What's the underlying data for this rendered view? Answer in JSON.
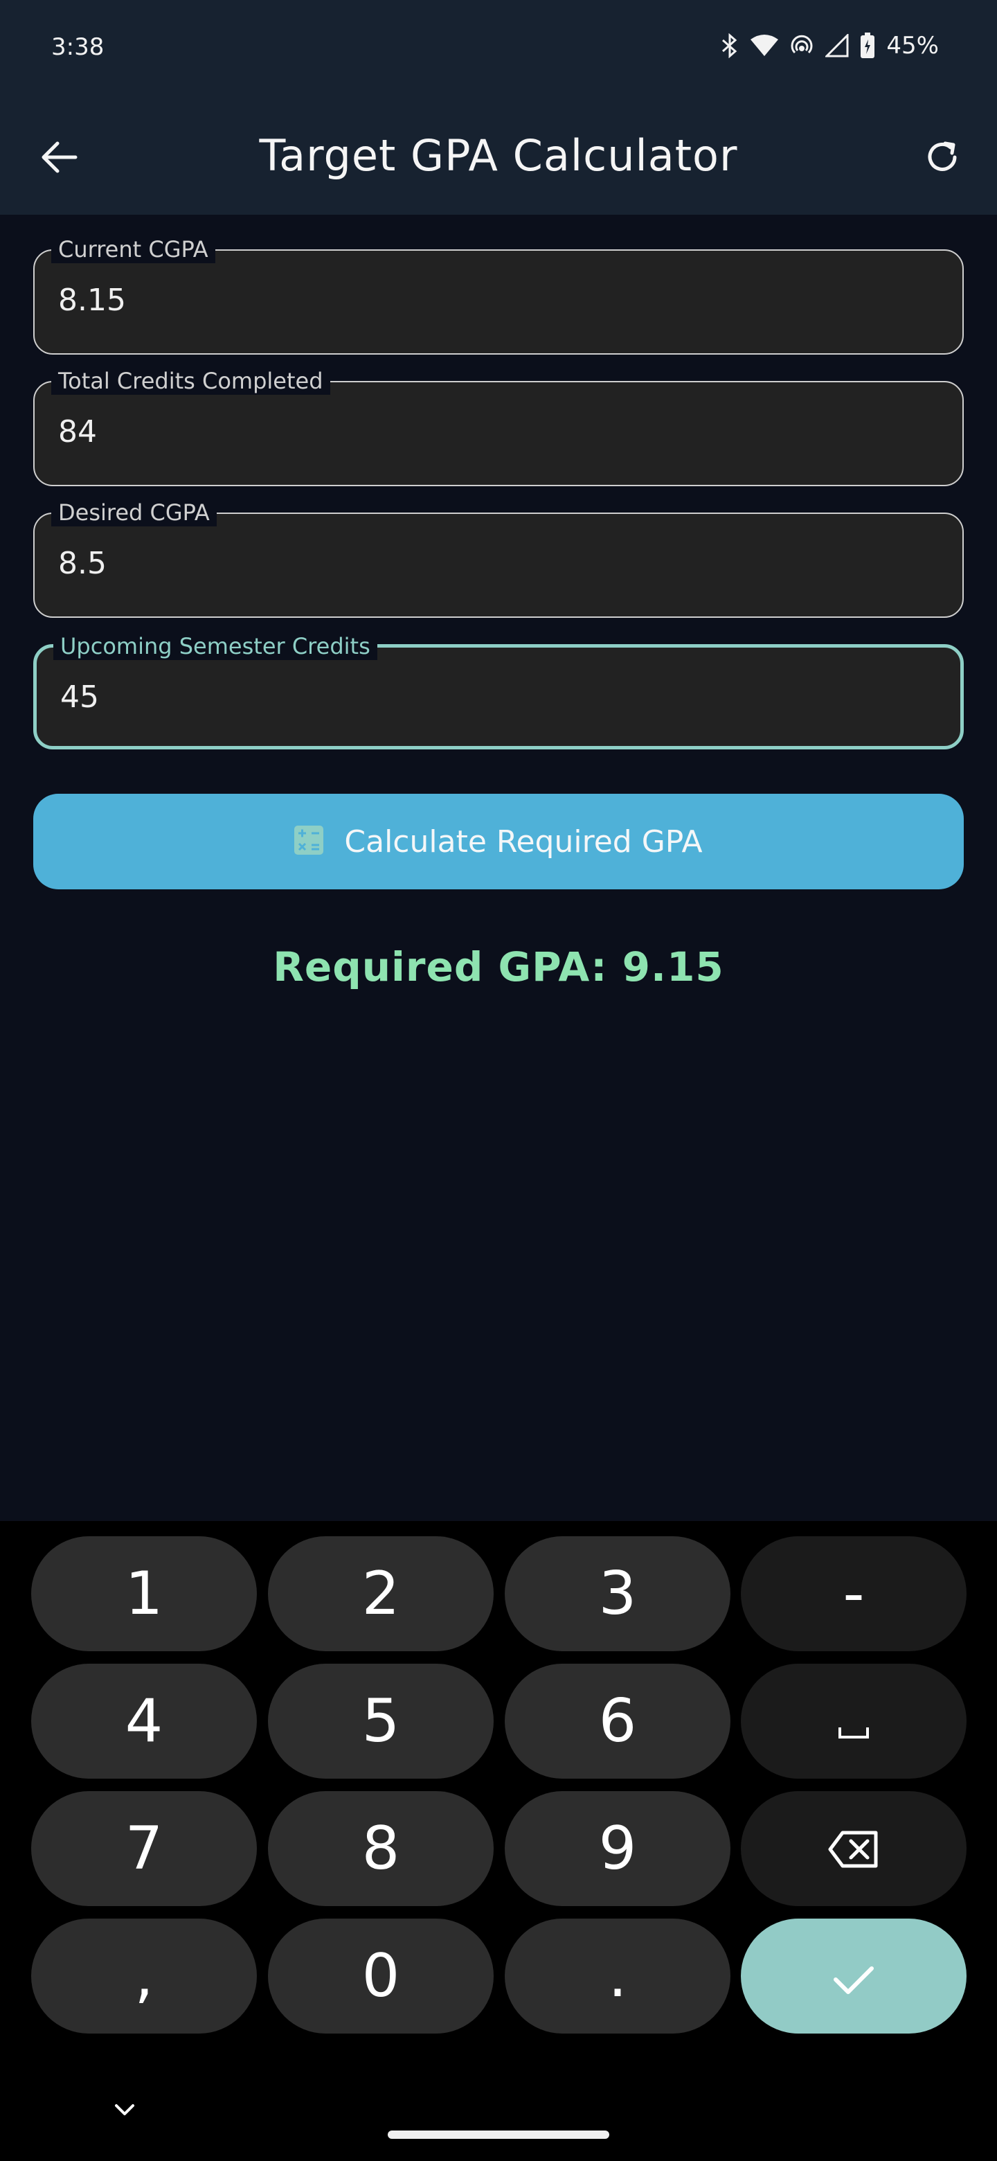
{
  "status": {
    "time": "3:38",
    "battery": "45%"
  },
  "appbar": {
    "title": "Target GPA Calculator"
  },
  "fields": [
    {
      "label": "Current CGPA",
      "value": "8.15"
    },
    {
      "label": "Total Credits Completed",
      "value": "84"
    },
    {
      "label": "Desired CGPA",
      "value": "8.5"
    },
    {
      "label": "Upcoming Semester Credits",
      "value": "45"
    }
  ],
  "calculate_button": {
    "label": "Calculate Required GPA",
    "icon": "calculator-icon"
  },
  "result": {
    "text": "Required GPA: 9.15"
  },
  "keyboard": {
    "keys": [
      "1",
      "2",
      "3",
      "-",
      "4",
      "5",
      "6",
      "␣",
      "7",
      "8",
      "9",
      "backspace",
      ",",
      "0",
      ".",
      "done"
    ]
  },
  "colors": {
    "accent": "#8ecfc6",
    "button": "#4fb1d8",
    "result": "#8ee3b0",
    "appbar": "#172230",
    "background": "#0b0f1b"
  }
}
